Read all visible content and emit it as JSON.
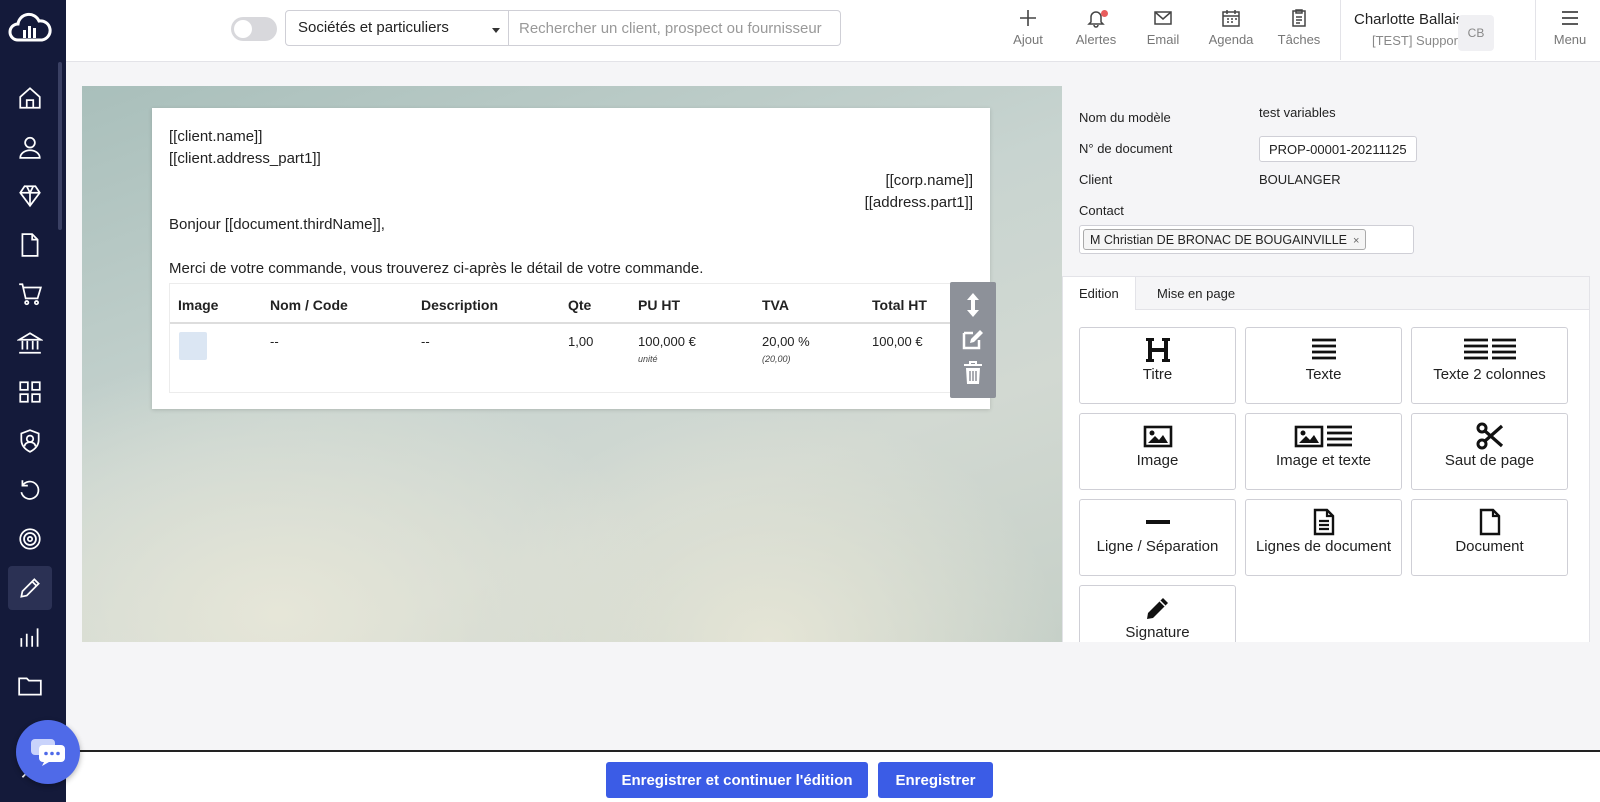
{
  "topbar": {
    "segment_select": "Sociétés et particuliers",
    "search_placeholder": "Rechercher un client, prospect ou fournisseur",
    "actions": [
      {
        "label": "Ajout",
        "icon": "plus-icon"
      },
      {
        "label": "Alertes",
        "icon": "bell-icon"
      },
      {
        "label": "Email",
        "icon": "envelope-icon"
      },
      {
        "label": "Agenda",
        "icon": "calendar-icon"
      },
      {
        "label": "Tâches",
        "icon": "clipboard-icon"
      }
    ],
    "user_name": "Charlotte Ballais",
    "user_role": "[TEST] Support",
    "avatar_initials": "CB",
    "menu_label": "Menu"
  },
  "sidebar": {
    "items": [
      "home-icon",
      "user-icon",
      "diamond-icon",
      "document-icon",
      "cart-icon",
      "bank-icon",
      "grid-icon",
      "shield-user-icon",
      "history-icon",
      "target-icon",
      "pencil-icon",
      "bar-chart-icon",
      "folder-icon"
    ],
    "active": "pencil-icon"
  },
  "document": {
    "client_name": "[[client.name]]",
    "client_address": "[[client.address_part1]]",
    "corp_name": "[[corp.name]]",
    "corp_address": "[[address.part1]]",
    "greeting": "Bonjour [[document.thirdName]],",
    "intro": "Merci de votre commande, vous trouverez ci-après le détail de votre commande.",
    "table": {
      "headers": [
        "Image",
        "Nom / Code",
        "Description",
        "Qte",
        "PU HT",
        "TVA",
        "Total HT"
      ],
      "row": {
        "name": "--",
        "description": "--",
        "qty": "1,00",
        "unit_price": "100,000 €",
        "unit_price_sub": "unité",
        "tva": "20,00 %",
        "tva_sub": "(20,00)",
        "total": "100,00 €"
      }
    }
  },
  "properties": {
    "model_name_label": "Nom du modèle",
    "model_name_value": "test variables",
    "doc_number_label": "N° de document",
    "doc_number_value": "PROP-00001-20211125",
    "client_label": "Client",
    "client_value": "BOULANGER",
    "contact_label": "Contact",
    "contact_tag": "M Christian DE BRONAC DE BOUGAINVILLE",
    "contact_remove": "×"
  },
  "panel": {
    "tabs": [
      "Edition",
      "Mise en page"
    ],
    "tiles": [
      "Titre",
      "Texte",
      "Texte 2 colonnes",
      "Image",
      "Image et texte",
      "Saut de page",
      "Ligne / Séparation",
      "Lignes de document",
      "Document",
      "Signature"
    ]
  },
  "footer": {
    "save_continue": "Enregistrer et continuer l'édition",
    "save": "Enregistrer"
  }
}
